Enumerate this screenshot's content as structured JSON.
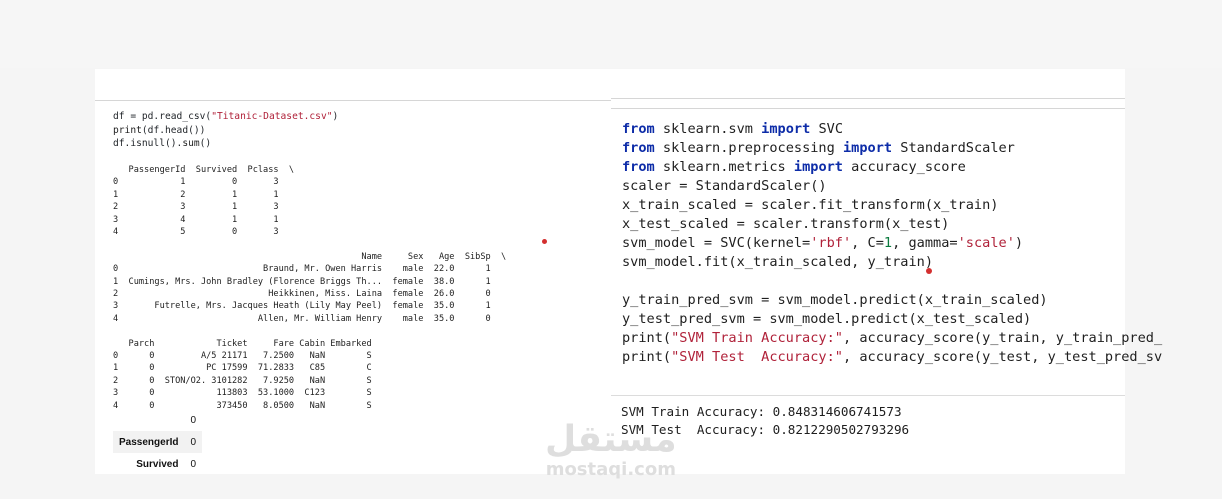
{
  "left_cell": {
    "code_lines": [
      {
        "plain1": "df = pd.read_csv(",
        "str": "\"Titanic-Dataset.csv\"",
        "plain2": ")"
      },
      {
        "fn": "print",
        "rest": "(df.head())"
      },
      {
        "plain1": "df.isnull().",
        "fn": "sum",
        "plain2": "()"
      }
    ],
    "output_lines": [
      "   PassengerId  Survived  Pclass  \\",
      "0            1         0       3",
      "1            2         1       1",
      "2            3         1       3",
      "3            4         1       1",
      "4            5         0       3",
      "",
      "                                                Name     Sex   Age  SibSp  \\",
      "0                            Braund, Mr. Owen Harris    male  22.0      1",
      "1  Cumings, Mrs. John Bradley (Florence Briggs Th...  female  38.0      1",
      "2                             Heikkinen, Miss. Laina  female  26.0      0",
      "3       Futrelle, Mrs. Jacques Heath (Lily May Peel)  female  35.0      1",
      "4                           Allen, Mr. William Henry    male  35.0      0",
      "",
      "   Parch            Ticket     Fare Cabin Embarked",
      "0      0         A/5 21171   7.2500   NaN        S",
      "1      0          PC 17599  71.2833   C85        C",
      "2      0  STON/O2. 3101282   7.9250   NaN        S",
      "3      0            113803  53.1000  C123        S",
      "4      0            373450   8.0500   NaN        S"
    ],
    "isnull_table": {
      "header": "0",
      "rows": [
        {
          "label": "PassengerId",
          "value": "0"
        },
        {
          "label": "Survived",
          "value": "0"
        }
      ]
    }
  },
  "right_cell": {
    "code": [
      [
        [
          "kw",
          "from"
        ],
        [
          "t",
          " sklearn.svm "
        ],
        [
          "kw",
          "import"
        ],
        [
          "t",
          " SVC"
        ]
      ],
      [
        [
          "kw",
          "from"
        ],
        [
          "t",
          " sklearn.preprocessing "
        ],
        [
          "kw",
          "import"
        ],
        [
          "t",
          " StandardScaler"
        ]
      ],
      [
        [
          "kw",
          "from"
        ],
        [
          "t",
          " sklearn.metrics "
        ],
        [
          "kw",
          "import"
        ],
        [
          "t",
          " accuracy_score"
        ]
      ],
      [
        [
          "t",
          "scaler = StandardScaler()"
        ]
      ],
      [
        [
          "t",
          "x_train_scaled = scaler.fit_transform(x_train)"
        ]
      ],
      [
        [
          "t",
          "x_test_scaled = scaler.transform(x_test)"
        ]
      ],
      [
        [
          "t",
          "svm_model = SVC(kernel="
        ],
        [
          "str",
          "'rbf'"
        ],
        [
          "t",
          ", C="
        ],
        [
          "num",
          "1"
        ],
        [
          "t",
          ", gamma="
        ],
        [
          "str",
          "'scale'"
        ],
        [
          "t",
          ")"
        ]
      ],
      [
        [
          "t",
          "svm_model.fit(x_train_scaled, y_train)"
        ]
      ],
      [
        [
          "t",
          ""
        ]
      ],
      [
        [
          "t",
          "y_train_pred_svm = svm_model.predict(x_train_scaled)"
        ]
      ],
      [
        [
          "t",
          "y_test_pred_svm = svm_model.predict(x_test_scaled)"
        ]
      ],
      [
        [
          "fn",
          "print"
        ],
        [
          "t",
          "("
        ],
        [
          "str",
          "\"SVM Train Accuracy:\""
        ],
        [
          "t",
          ", accuracy_score(y_train, y_train_pred_"
        ]
      ],
      [
        [
          "fn",
          "print"
        ],
        [
          "t",
          "("
        ],
        [
          "str",
          "\"SVM Test  Accuracy:\""
        ],
        [
          "t",
          ", accuracy_score(y_test, y_test_pred_sv"
        ]
      ]
    ],
    "output_lines": [
      "SVM Train Accuracy: 0.848314606741573",
      "SVM Test  Accuracy: 0.8212290502793296"
    ]
  },
  "watermark": {
    "logo": "مستقل",
    "text": "mostaqi.com"
  },
  "colors": {
    "keyword": "#0d2ca8",
    "string": "#b0223a",
    "number": "#0a7a3d",
    "annotation_dot": "#d32f2f"
  }
}
